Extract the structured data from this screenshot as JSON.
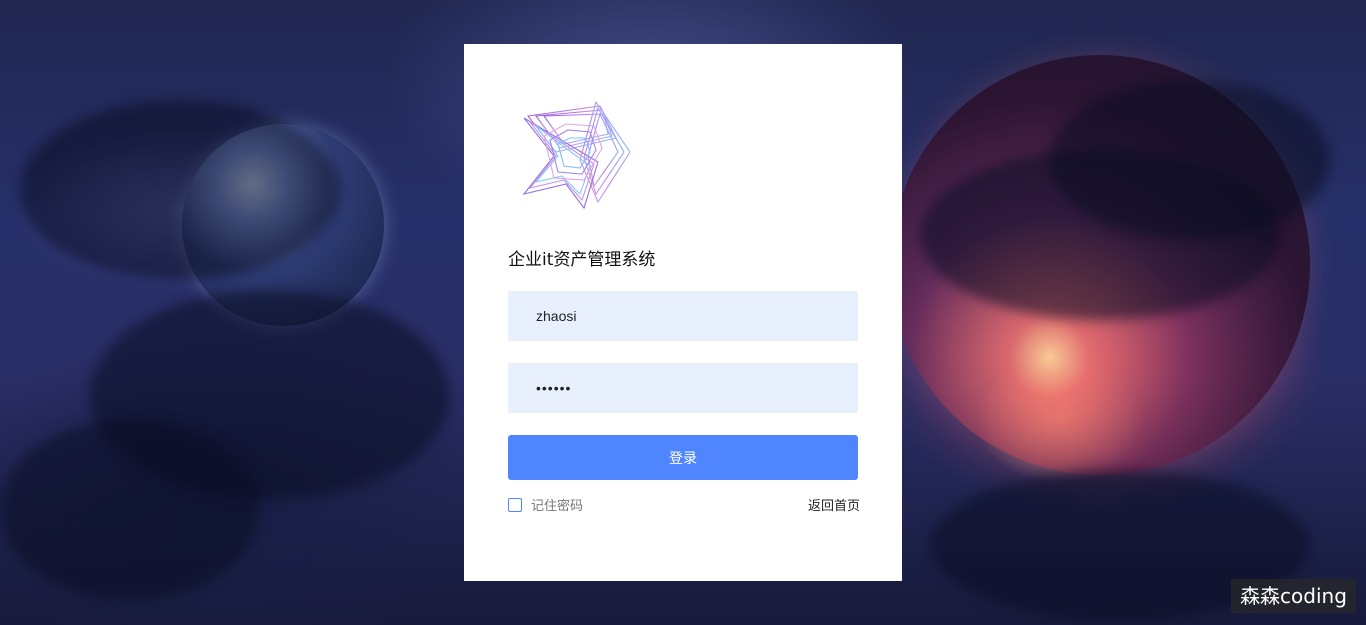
{
  "login": {
    "logo_icon": "star-logo-icon",
    "title": "企业it资产管理系统",
    "username_value": "zhaosi",
    "password_value": "••••••",
    "login_button": "登录",
    "remember_label": "记住密码",
    "back_home": "返回首页"
  },
  "watermark": {
    "text": "森森coding"
  },
  "colors": {
    "primary": "#4f86ff",
    "input_bg": "#e8f0fe",
    "card_bg": "#ffffff"
  }
}
